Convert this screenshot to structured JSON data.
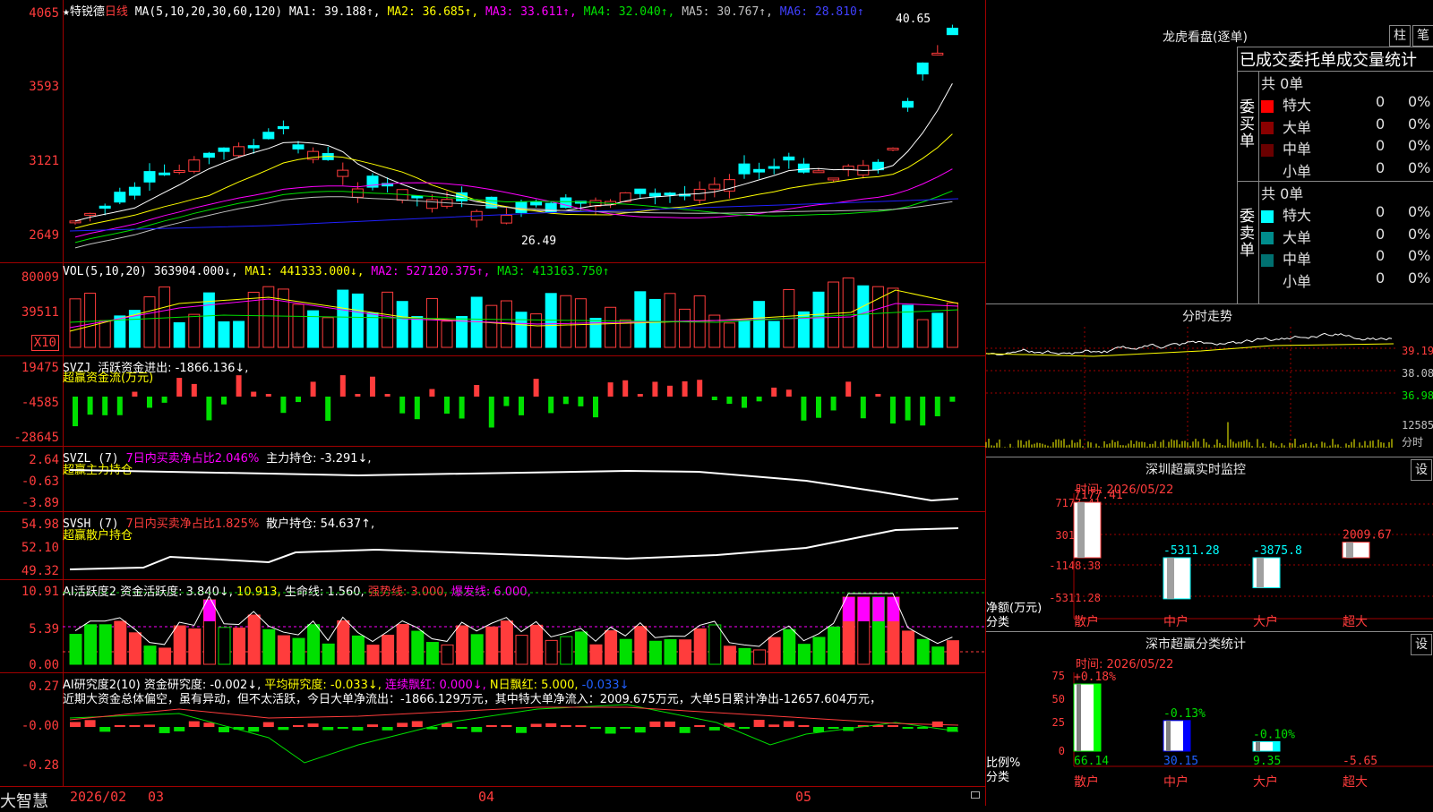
{
  "colors": {
    "up": "#ff3c3c",
    "down": "#00ffff",
    "ma1": "#ffffff",
    "ma2": "#ffff00",
    "ma3": "#ff00ff",
    "ma4": "#00e000",
    "ma5": "#c0c0c0",
    "ma6": "#2020ff",
    "green": "#00e000",
    "grid": "#a00000"
  },
  "kline": {
    "star": "★",
    "name": "特锐德",
    "period": "日线",
    "ma_params": "MA(5,10,20,30,60,120)",
    "ma1": "MA1: 39.188↑,",
    "ma2": "MA2: 36.685↑,",
    "ma3": "MA3: 33.611↑,",
    "ma4": "MA4: 32.040↑,",
    "ma5": "MA5: 30.767↑,",
    "ma6": "MA6: 28.810↑",
    "y_ticks": [
      "4065",
      "3593",
      "3121",
      "2649"
    ],
    "high_label": "40.65",
    "low_label": "26.49"
  },
  "vol": {
    "params": "VOL(5,10,20)",
    "vol": "363904.000↓,",
    "ma1": "MA1: 441333.000↓,",
    "ma2": "MA2: 527120.375↑,",
    "ma3": "MA3: 413163.750↑",
    "y_ticks": [
      "80009",
      "39511"
    ],
    "unit": "X10"
  },
  "svzj": {
    "name": "SVZJ",
    "value": "活跃资金进出: -1866.136↓,",
    "label": "超赢资金流(万元)",
    "y_ticks": [
      "19475",
      "-4585",
      "-28645"
    ]
  },
  "svzl": {
    "name": "SVZL (7)",
    "value": "7日内买卖净占比2.046%",
    "value2": "主力持仓: -3.291↓,",
    "label": "超赢主力持仓",
    "y_ticks": [
      "2.64",
      "-0.63",
      "-3.89"
    ]
  },
  "svsh": {
    "name": "SVSH (7)",
    "value": "7日内买卖净占比1.825%",
    "value2": "散户持仓: 54.637↑,",
    "label": "超赢散户持仓",
    "y_ticks": [
      "54.98",
      "52.10",
      "49.32"
    ]
  },
  "ai_active": {
    "name": "AI活跃度2",
    "v1": "资金活跃度: 3.840↓,",
    "v2": "10.913,",
    "v3": "生命线: 1.560,",
    "v4": "强势线: 3.000,",
    "v5": "爆发线: 6.000,",
    "y_ticks": [
      "10.91",
      "5.39",
      "0.00"
    ]
  },
  "ai_research": {
    "name": "AI研究度2(10)",
    "v1": "资金研究度: -0.002↓,",
    "v2": "平均研究度: -0.033↓,",
    "v3": "连续飘红: 0.000↓,",
    "v4": "N日飘红: 5.000,",
    "v5": "-0.033↓",
    "comment": "近期大资金总体偏空，虽有异动，但不太活跃，今日大单净流出：-1866.129万元，其中特大单净流入：2009.675万元，大单5日累计净出-12657.604万元，",
    "y_ticks": [
      "0.27",
      "-0.00",
      "-0.28"
    ]
  },
  "bottom": {
    "brand": "大智慧",
    "x_labels": [
      "2026/02",
      "03",
      "04",
      "05"
    ]
  },
  "dragon": {
    "title": "龙虎看盘(逐单)",
    "btn1": "柱",
    "btn2": "笔",
    "header": "已成交委托单成交量统计",
    "buy_label": "委买单",
    "sell_label": "委卖单",
    "buy_total": "共 0单",
    "sell_total": "共 0单",
    "buy_rows": [
      {
        "name": "特大",
        "count": "0",
        "pct": "0%",
        "color": "#ff0000"
      },
      {
        "name": "大单",
        "count": "0",
        "pct": "0%",
        "color": "#8a0000"
      },
      {
        "name": "中单",
        "count": "0",
        "pct": "0%",
        "color": "#6a0000"
      },
      {
        "name": "小单",
        "count": "0",
        "pct": "0%",
        "color": "#000000"
      }
    ],
    "sell_rows": [
      {
        "name": "特大",
        "count": "0",
        "pct": "0%",
        "color": "#00ffff"
      },
      {
        "name": "大单",
        "count": "0",
        "pct": "0%",
        "color": "#008c8c"
      },
      {
        "name": "中单",
        "count": "0",
        "pct": "0%",
        "color": "#007070"
      },
      {
        "name": "小单",
        "count": "0",
        "pct": "0%",
        "color": "#000000"
      }
    ]
  },
  "intraday": {
    "title": "分时走势",
    "y_ticks": [
      "39.19",
      "38.08",
      "36.98"
    ],
    "vol_tick": "12585",
    "footer": "分时"
  },
  "sz_monitor": {
    "title": "深圳超赢实时监控",
    "btn": "设",
    "time": "时间: 2026/05/22",
    "y_ticks": [
      "7177.41",
      "3014.51",
      "-1148.38",
      "-5311.28"
    ],
    "unit": "净额(万元)",
    "category_word": "分类",
    "categories": [
      "散户",
      "中户",
      "大户",
      "超大"
    ],
    "values": [
      7177.41,
      -5311.28,
      -3875.8,
      2009.67
    ],
    "value_labels": [
      "7177.41",
      "-5311.28",
      "-3875.8",
      "2009.67"
    ]
  },
  "sz_class": {
    "title": "深市超赢分类统计",
    "btn": "设",
    "time": "时间: 2026/05/22",
    "y_ticks": [
      "75",
      "50",
      "25",
      "0"
    ],
    "unit": "比例%",
    "category_word": "分类",
    "categories": [
      "散户",
      "中户",
      "大户",
      "超大"
    ],
    "ratios": [
      "66.14",
      "30.15",
      "9.35",
      "-5.65"
    ],
    "changes": [
      "+0.18%",
      "-0.13%",
      "-0.10%",
      ""
    ]
  }
}
